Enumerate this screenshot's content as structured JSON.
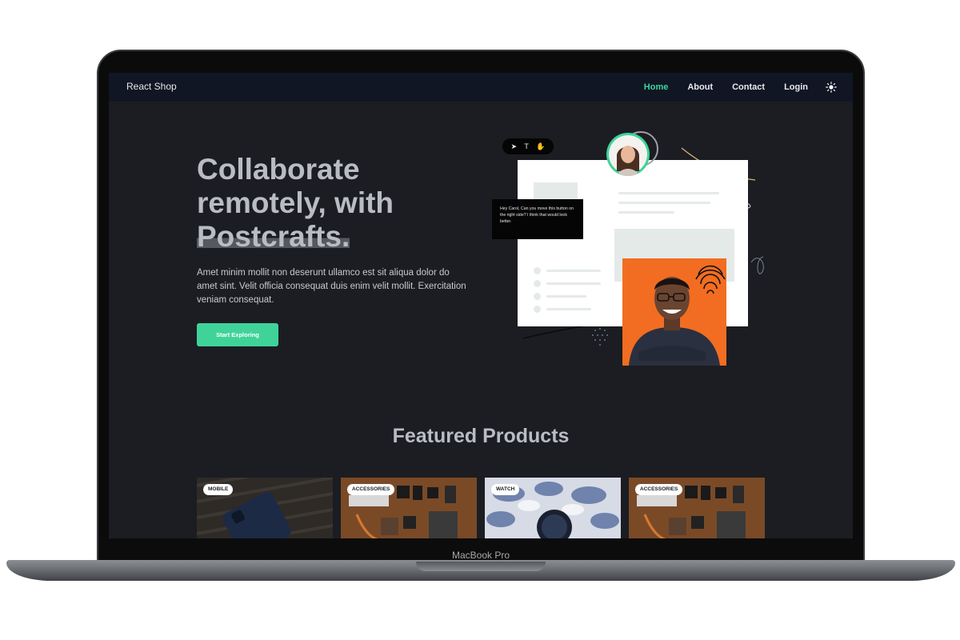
{
  "laptop": {
    "label": "MacBook Pro"
  },
  "navbar": {
    "brand": "React Shop",
    "links": [
      {
        "label": "Home",
        "active": true
      },
      {
        "label": "About",
        "active": false
      },
      {
        "label": "Contact",
        "active": false
      },
      {
        "label": "Login",
        "active": false
      }
    ],
    "theme_toggle_icon": "sun-icon"
  },
  "hero": {
    "title_line1": "Collaborate",
    "title_line2": "remotely, with",
    "title_highlight": "Postcrafts.",
    "description": "Amet minim mollit non deserunt ullamco est sit aliqua dolor do amet sint. Velit officia consequat duis enim velit mollit. Exercitation veniam consequat.",
    "cta_label": "Start Exploring",
    "comment_text": "Hey Carol, Can you move this button on the right side? I think that would look better."
  },
  "featured": {
    "title": "Featured Products",
    "products": [
      {
        "badge": "MOBILE"
      },
      {
        "badge": "ACCESSORIES"
      },
      {
        "badge": "WATCH"
      },
      {
        "badge": "ACCESSORIES"
      }
    ]
  },
  "colors": {
    "accent": "#3fd39a",
    "background": "#1b1d22",
    "navbar": "#101624",
    "photo_bg": "#f26d21"
  }
}
